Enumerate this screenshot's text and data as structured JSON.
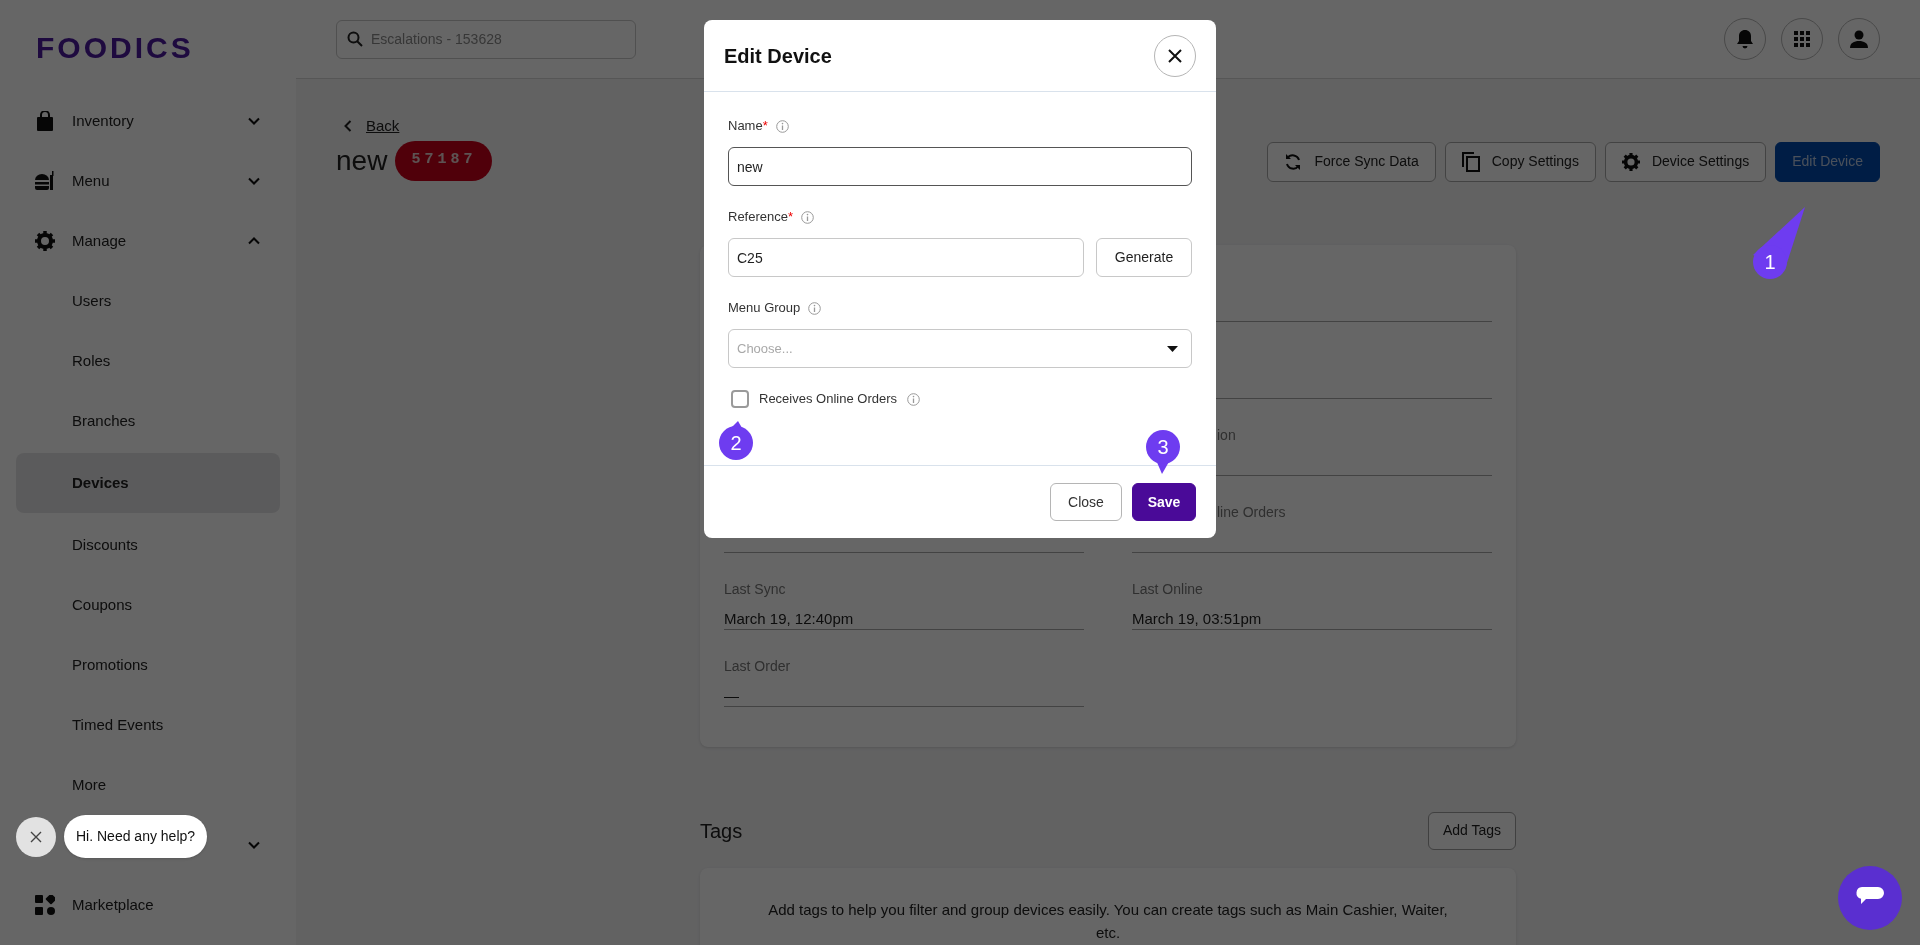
{
  "logo": "FOODICS",
  "sidebar": {
    "items": [
      {
        "label": "Inventory",
        "expanded": false,
        "selected": false
      },
      {
        "label": "Menu",
        "expanded": false,
        "selected": false
      },
      {
        "label": "Manage",
        "expanded": true,
        "selected": false,
        "children": [
          {
            "label": "Users",
            "selected": false
          },
          {
            "label": "Roles",
            "selected": false
          },
          {
            "label": "Branches",
            "selected": false
          },
          {
            "label": "Devices",
            "selected": true
          },
          {
            "label": "Discounts",
            "selected": false
          },
          {
            "label": "Coupons",
            "selected": false
          },
          {
            "label": "Promotions",
            "selected": false
          },
          {
            "label": "Timed Events",
            "selected": false
          },
          {
            "label": "More",
            "selected": false
          }
        ]
      },
      {
        "expanded": false
      },
      {
        "label": "Marketplace",
        "selected": false
      }
    ]
  },
  "header": {
    "search": {
      "placeholder": "Escalations - 153628"
    }
  },
  "page": {
    "back": "Back",
    "title": "new",
    "badge": "57187",
    "actions": [
      {
        "label": "Force Sync Data",
        "kind": "outline"
      },
      {
        "label": "Copy Settings",
        "kind": "outline"
      },
      {
        "label": "Device Settings",
        "kind": "outline"
      },
      {
        "label": "Edit Device",
        "kind": "primary"
      }
    ],
    "details": {
      "covered_labels": [
        "ion",
        "line Orders"
      ],
      "fields": [
        {
          "label": "Last Sync",
          "value": "March 19, 12:40pm"
        },
        {
          "label": "Last Online",
          "value": "March 19, 03:51pm"
        },
        {
          "label": "Last Order",
          "value": "—"
        }
      ]
    },
    "tags": {
      "title": "Tags",
      "button": "Add Tags",
      "empty_text": "Add tags to help you filter and group devices easily. You can create tags such as Main Cashier, Waiter, etc."
    }
  },
  "modal": {
    "title": "Edit Device",
    "name": {
      "label": "Name",
      "required_mark": "*",
      "value": "new"
    },
    "reference": {
      "label": "Reference",
      "required_mark": "*",
      "value": "C25",
      "button": "Generate"
    },
    "menu_group": {
      "label": "Menu Group",
      "placeholder": "Choose..."
    },
    "online_orders": {
      "label": "Receives Online Orders",
      "checked": false
    },
    "buttons": [
      {
        "label": "Close",
        "kind": "secondary"
      },
      {
        "label": "Save",
        "kind": "primary"
      }
    ]
  },
  "annotations": [
    {
      "label": "1"
    },
    {
      "label": "2"
    },
    {
      "label": "3"
    }
  ],
  "help_bubble": {
    "text": "Hi. Need any help?"
  }
}
